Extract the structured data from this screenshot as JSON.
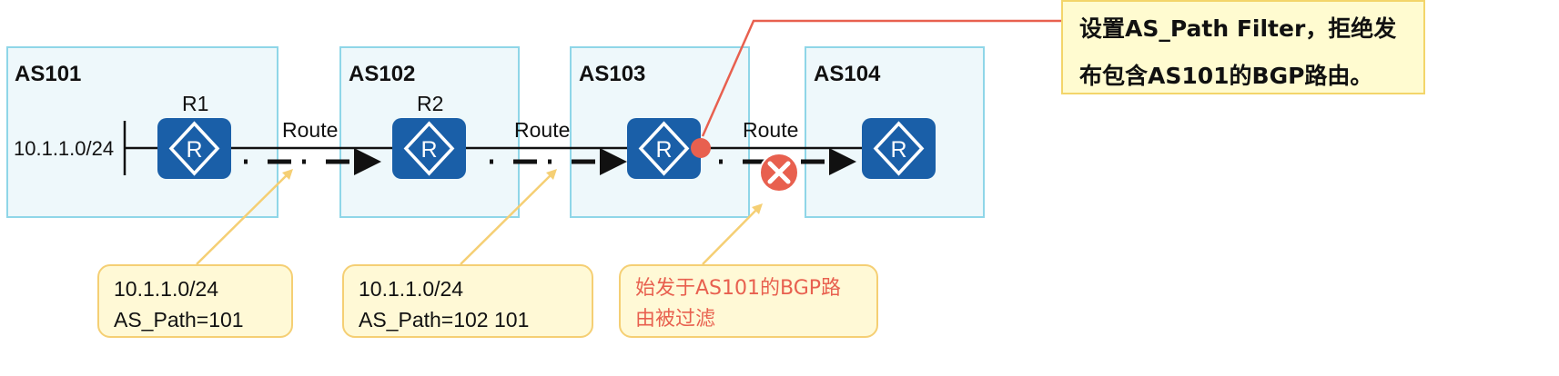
{
  "autonomous_systems": [
    {
      "name": "AS101"
    },
    {
      "name": "AS102"
    },
    {
      "name": "AS103"
    },
    {
      "name": "AS104"
    }
  ],
  "routers": [
    {
      "name": "R1"
    },
    {
      "name": "R2"
    }
  ],
  "network_prefix": "10.1.1.0/24",
  "route_label": "Route",
  "router_symbol": "R",
  "router_icon": "router-icon",
  "filter_icon": "filter-deny-icon",
  "colors": {
    "as_box_fill": "#eef8fb",
    "as_box_border": "#8fd6e8",
    "router_fill": "#1a5fa8",
    "callout_fill": "#fff9d6",
    "callout_border": "#f5cf74",
    "leader_line": "#f5cf74",
    "note_leader": "#e8604f",
    "deny_fill": "#e8604f",
    "filtered_text": "#e8604f"
  },
  "callouts": [
    {
      "lines": [
        "10.1.1.0/24",
        "AS_Path=101"
      ]
    },
    {
      "lines": [
        "10.1.1.0/24",
        "AS_Path=102 101"
      ]
    },
    {
      "lines": [
        "始发于AS101的BGP路",
        "由被过滤"
      ]
    }
  ],
  "note": {
    "lines": [
      "设置AS_Path  Filter，拒绝发",
      "布包含AS101的BGP路由。"
    ]
  }
}
